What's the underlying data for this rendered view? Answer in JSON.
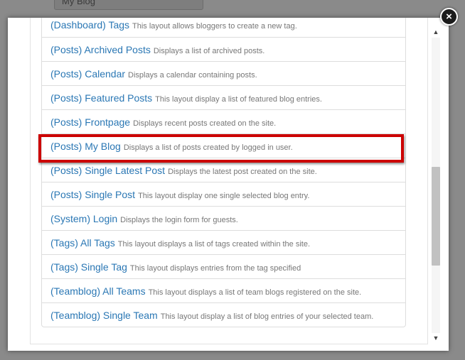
{
  "background": {
    "field_value": "My Blog"
  },
  "modal": {
    "close_label": "×",
    "layouts": [
      {
        "title": "(Dashboard) Tags",
        "desc": "This layout allows bloggers to create a new tag."
      },
      {
        "title": "(Posts) Archived Posts",
        "desc": "Displays a list of archived posts."
      },
      {
        "title": "(Posts) Calendar",
        "desc": "Displays a calendar containing posts."
      },
      {
        "title": "(Posts) Featured Posts",
        "desc": "This layout display a list of featured blog entries."
      },
      {
        "title": "(Posts) Frontpage",
        "desc": "Displays recent posts created on the site."
      },
      {
        "title": "(Posts) My Blog",
        "desc": "Displays a list of posts created by logged in user."
      },
      {
        "title": "(Posts) Single Latest Post",
        "desc": "Displays the latest post created on the site."
      },
      {
        "title": "(Posts) Single Post",
        "desc": "This layout display one single selected blog entry."
      },
      {
        "title": "(System) Login",
        "desc": "Displays the login form for guests."
      },
      {
        "title": "(Tags) All Tags",
        "desc": "This layout displays a list of tags created within the site."
      },
      {
        "title": "(Tags) Single Tag",
        "desc": "This layout displays entries from the tag specified"
      },
      {
        "title": "(Teamblog) All Teams",
        "desc": "This layout displays a list of team blogs registered on the site."
      },
      {
        "title": "(Teamblog) Single Team",
        "desc": "This layout display a list of blog entries of your selected team."
      }
    ],
    "scrollbar": {
      "up": "▲",
      "down": "▼"
    }
  },
  "colors": {
    "link": "#2a77b4",
    "highlight": "#cc0000"
  }
}
